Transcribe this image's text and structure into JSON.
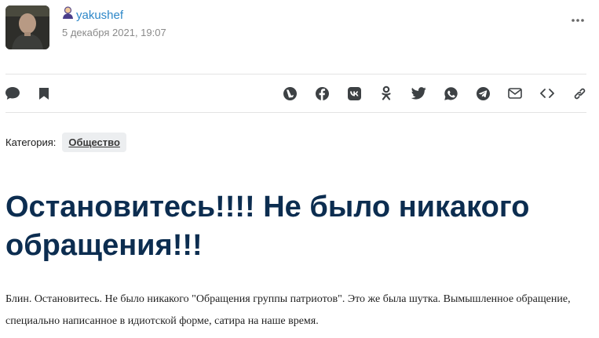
{
  "post": {
    "author": "yakushef",
    "date": "5 декабря 2021, 19:07",
    "category_label": "Категория:",
    "category": "Общество",
    "title": "Остановитесь!!!! Не было никакого обращения!!!",
    "body": "Блин. Остановитесь. Не было никакого \"Обращения группы патриотов\". Это же была шутка. Вымышленное обращение, специально написанное в идиотской форме, сатира на наше время."
  },
  "toolbar_left": [
    "comment-icon",
    "bookmark-icon"
  ],
  "share_icons": [
    "livejournal-icon",
    "facebook-icon",
    "vk-icon",
    "odnoklassniki-icon",
    "twitter-icon",
    "whatsapp-icon",
    "telegram-icon",
    "email-icon",
    "embed-icon",
    "link-icon"
  ],
  "colors": {
    "author_link": "#2d87c8",
    "title": "#0c2d50",
    "icon": "#3d4144",
    "separator": "#e3e3e3",
    "category_pill_bg": "#eceef0"
  }
}
